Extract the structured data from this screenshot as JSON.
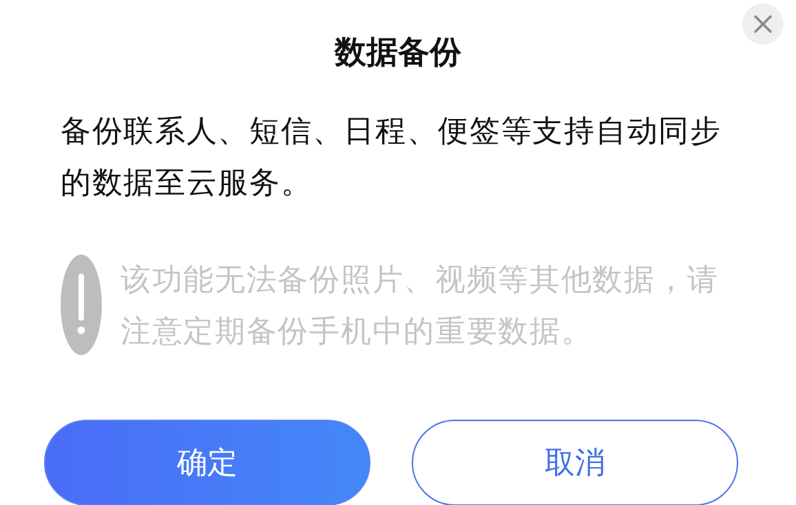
{
  "dialog": {
    "title": "数据备份",
    "message": "备份联系人、短信、日程、便签等支持自动同步的数据至云服务。",
    "warning": "该功能无法备份照片、视频等其他数据，请注意定期备份手机中的重要数据。"
  },
  "buttons": [
    {
      "label": "确定",
      "kind": "primary"
    },
    {
      "label": "取消",
      "kind": "secondary"
    }
  ]
}
